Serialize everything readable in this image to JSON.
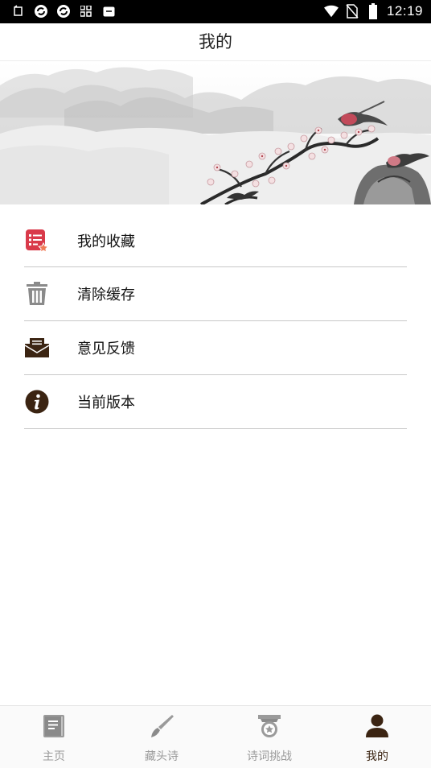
{
  "status_bar": {
    "time": "12:19",
    "left_icons": [
      "notification-icon",
      "sync-icon",
      "sync-icon",
      "app-grid-icon",
      "app-icon"
    ],
    "right_icons": [
      "wifi-icon",
      "no-sim-icon",
      "battery-icon"
    ]
  },
  "header": {
    "title": "我的"
  },
  "menu": {
    "items": [
      {
        "label": "我的收藏",
        "icon": "favorites-list-icon",
        "color": "#d93a4a"
      },
      {
        "label": "清除缓存",
        "icon": "trash-icon",
        "color": "#8a8a8a"
      },
      {
        "label": "意见反馈",
        "icon": "feedback-inbox-icon",
        "color": "#3b2412"
      },
      {
        "label": "当前版本",
        "icon": "info-icon",
        "color": "#3b2412"
      }
    ]
  },
  "bottom_nav": {
    "items": [
      {
        "label": "主页",
        "icon": "book-icon",
        "active": false
      },
      {
        "label": "藏头诗",
        "icon": "brush-icon",
        "active": false
      },
      {
        "label": "诗词挑战",
        "icon": "trophy-icon",
        "active": false
      },
      {
        "label": "我的",
        "icon": "user-icon",
        "active": true
      }
    ]
  },
  "colors": {
    "accent": "#3b2412",
    "inactive": "#9a9a9a",
    "favorite_red": "#d93a4a",
    "divider": "#c8c8c8"
  }
}
